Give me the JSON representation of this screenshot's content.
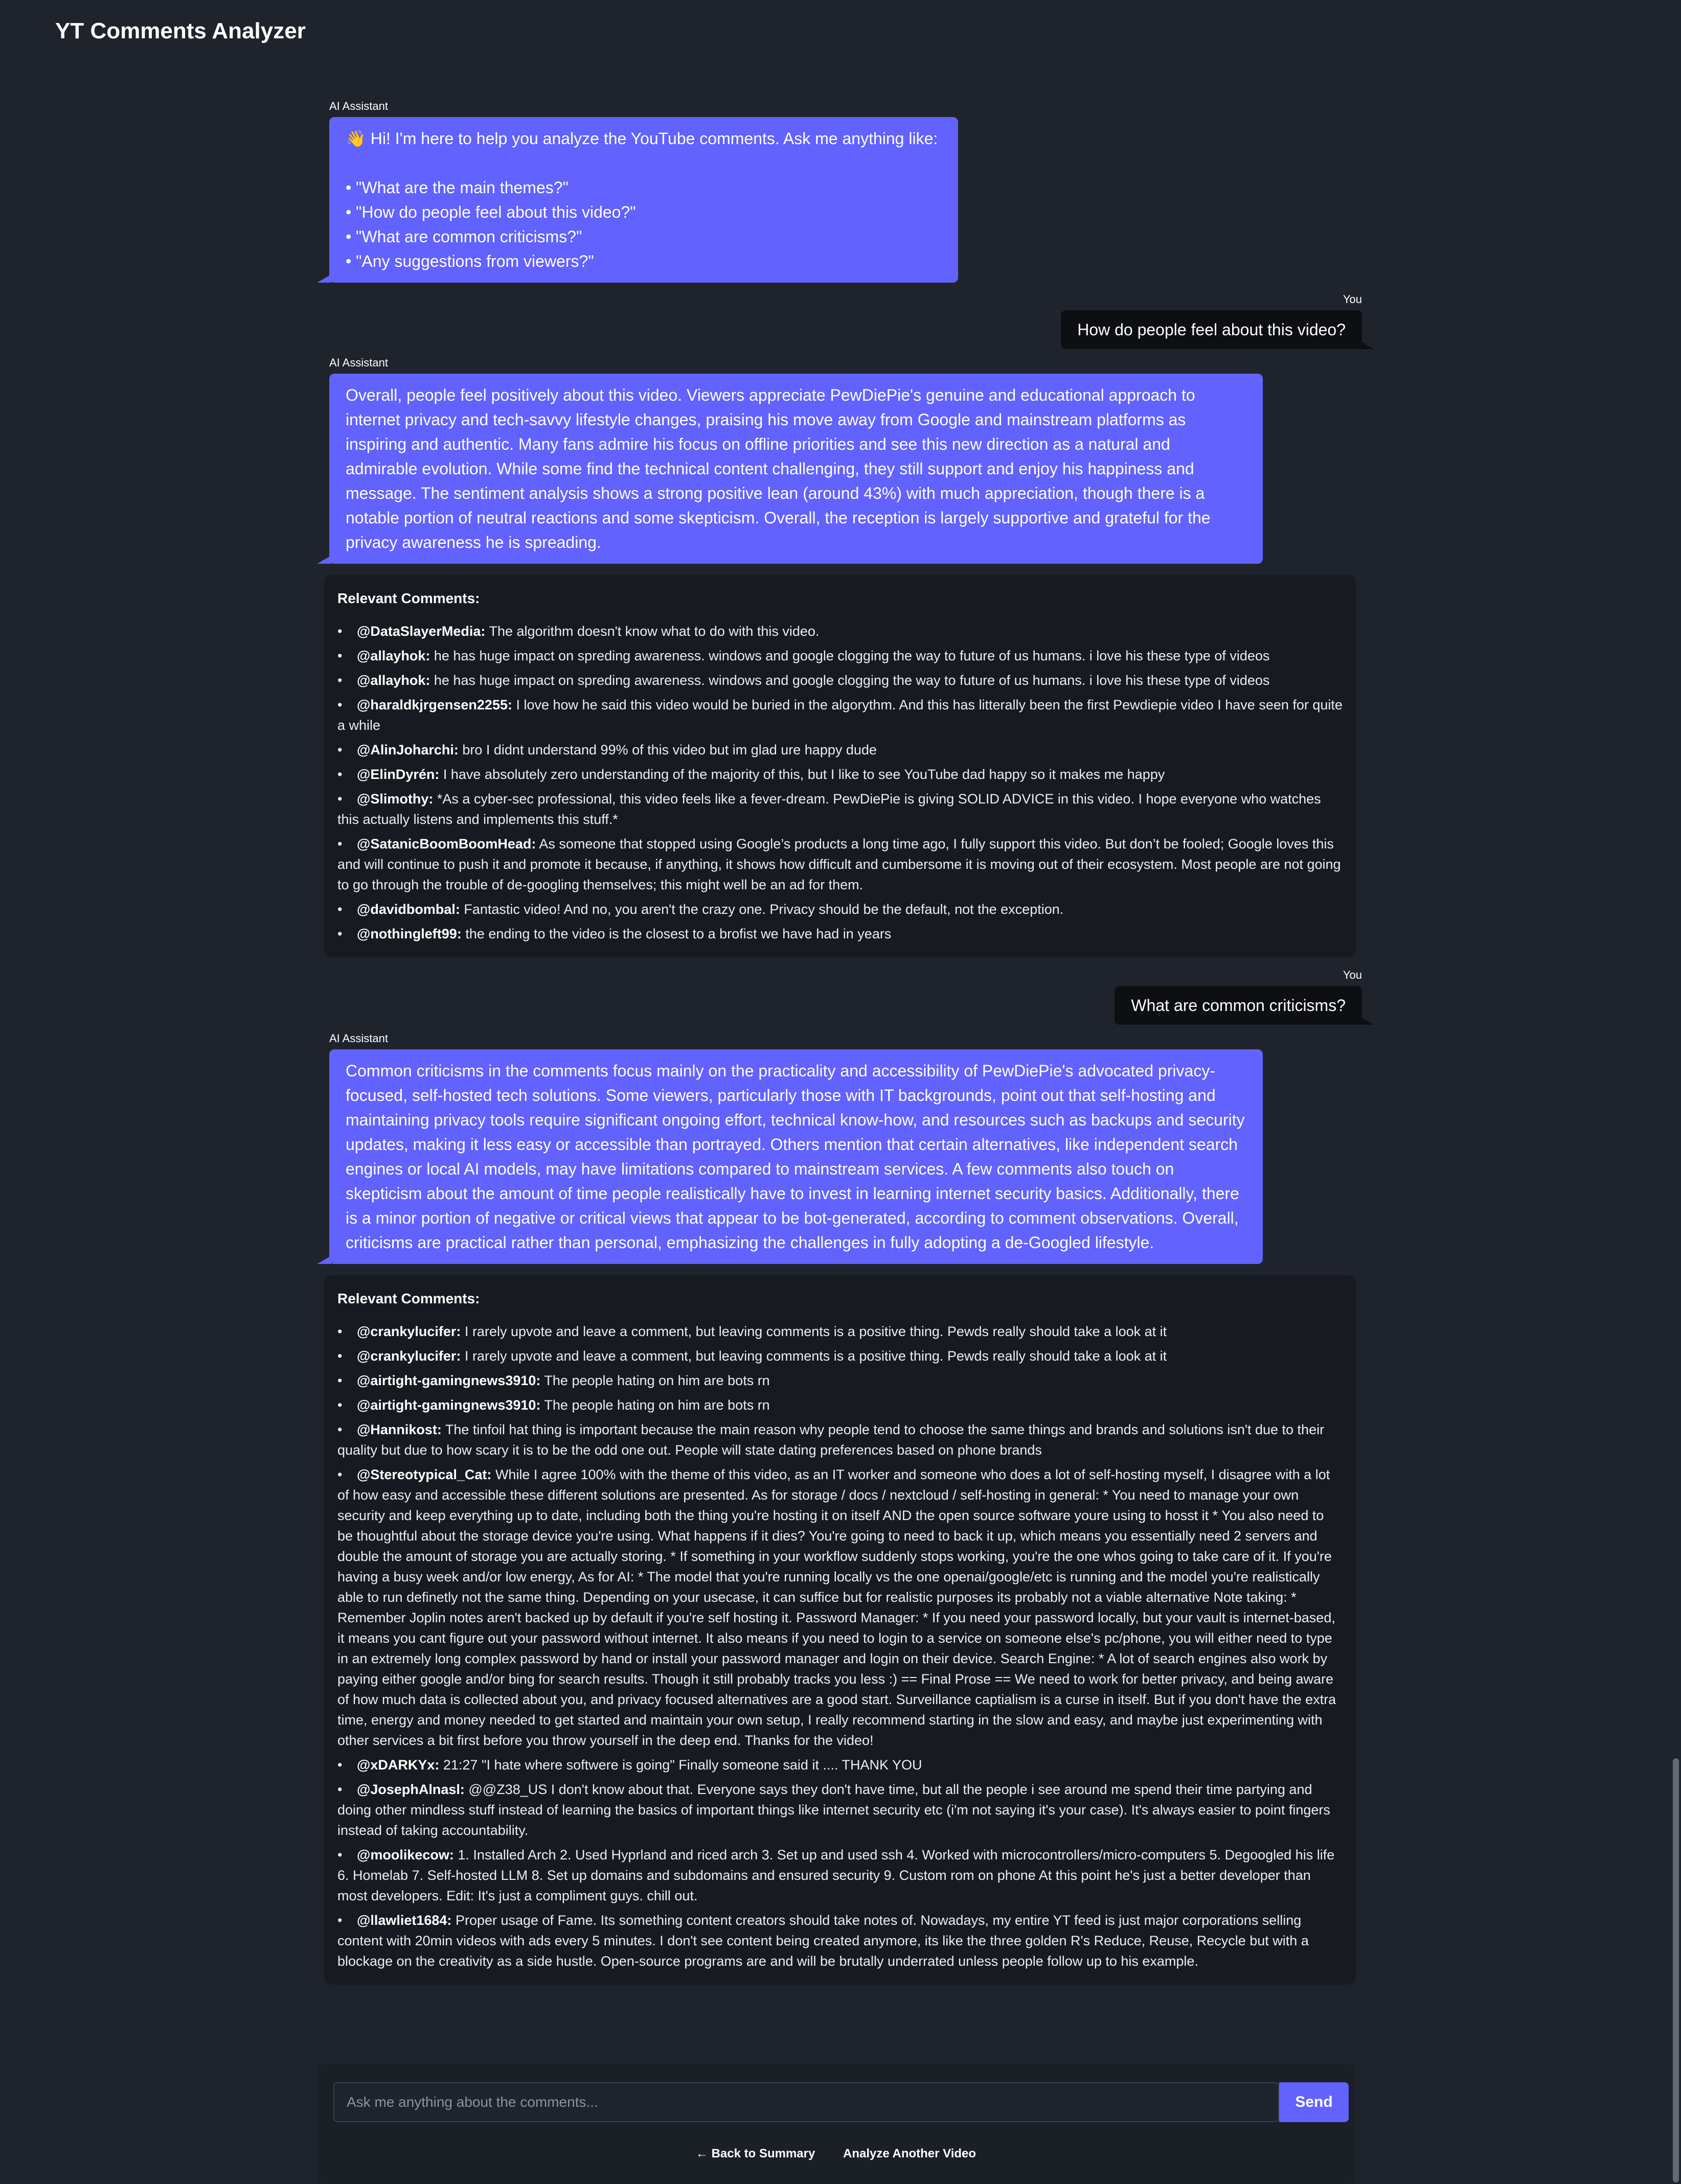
{
  "app": {
    "title": "YT Comments Analyzer"
  },
  "labels": {
    "ai": "AI Assistant",
    "user": "You"
  },
  "greeting": {
    "text": "👋 Hi! I'm here to help you analyze the YouTube comments. Ask me anything like:",
    "examples": [
      "• \"What are the main themes?\"",
      "• \"How do people feel about this video?\"",
      "• \"What are common criticisms?\"",
      "• \"Any suggestions from viewers?\""
    ]
  },
  "q1": {
    "text": "How do people feel about this video?"
  },
  "a1": {
    "text": "Overall, people feel positively about this video. Viewers appreciate PewDiePie's genuine and educational approach to internet privacy and tech-savvy lifestyle changes, praising his move away from Google and mainstream platforms as inspiring and authentic. Many fans admire his focus on offline priorities and see this new direction as a natural and admirable evolution. While some find the technical content challenging, they still support and enjoy his happiness and message. The sentiment analysis shows a strong positive lean (around 43%) with much appreciation, though there is a notable portion of neutral reactions and some skepticism. Overall, the reception is largely supportive and grateful for the privacy awareness he is spreading."
  },
  "comments_title": "Relevant Comments:",
  "c1": [
    {
      "user": "@DataSlayerMedia:",
      "text": "The algorithm doesn't know what to do with this video."
    },
    {
      "user": "@allayhok:",
      "text": "he has huge impact on spreding awareness. windows and google clogging the way to future of us humans. i love his these type of videos"
    },
    {
      "user": "@allayhok:",
      "text": "he has huge impact on spreding awareness. windows and google clogging the way to future of us humans. i love his these type of videos"
    },
    {
      "user": "@haraldkjrgensen2255:",
      "text": "I love how he said this video would be buried in the algorythm. And this has litterally been the first Pewdiepie video I have seen for quite a while"
    },
    {
      "user": "@AlinJoharchi:",
      "text": "bro I didnt understand 99% of this video but im glad ure happy dude"
    },
    {
      "user": "@ElinDyrén:",
      "text": "I have absolutely zero understanding of the majority of this, but I like to see YouTube dad happy so it makes me happy"
    },
    {
      "user": "@Slimothy:",
      "text": "*As a cyber-sec professional, this video feels like a fever-dream. PewDiePie is giving SOLID ADVICE in this video. I hope everyone who watches this actually listens and implements this stuff.*"
    },
    {
      "user": "@SatanicBoomBoomHead:",
      "text": "As someone that stopped using Google’s products a long time ago, I fully support this video. But don’t be fooled; Google loves this and will continue to push it and promote it because, if anything, it shows how difficult and cumbersome it is moving out of their ecosystem. Most people are not going to go through the trouble of de-googling themselves; this might well be an ad for them."
    },
    {
      "user": "@davidbombal:",
      "text": "Fantastic video! And no, you aren't the crazy one. Privacy should be the default, not the exception."
    },
    {
      "user": "@nothingleft99:",
      "text": "the ending to the video is the closest to a brofist we have had in years"
    }
  ],
  "q2": {
    "text": "What are common criticisms?"
  },
  "a2": {
    "text": "Common criticisms in the comments focus mainly on the practicality and accessibility of PewDiePie's advocated privacy-focused, self-hosted tech solutions. Some viewers, particularly those with IT backgrounds, point out that self-hosting and maintaining privacy tools require significant ongoing effort, technical know-how, and resources such as backups and security updates, making it less easy or accessible than portrayed. Others mention that certain alternatives, like independent search engines or local AI models, may have limitations compared to mainstream services. A few comments also touch on skepticism about the amount of time people realistically have to invest in learning internet security basics. Additionally, there is a minor portion of negative or critical views that appear to be bot-generated, according to comment observations. Overall, criticisms are practical rather than personal, emphasizing the challenges in fully adopting a de-Googled lifestyle."
  },
  "c2": [
    {
      "user": "@crankylucifer:",
      "text": "I rarely upvote and leave a comment, but leaving comments is a positive thing. Pewds really should take a look at it"
    },
    {
      "user": "@crankylucifer:",
      "text": "I rarely upvote and leave a comment, but leaving comments is a positive thing. Pewds really should take a look at it"
    },
    {
      "user": "@airtight-gamingnews3910:",
      "text": "The people hating on him are bots rn"
    },
    {
      "user": "@airtight-gamingnews3910:",
      "text": "The people hating on him are bots rn"
    },
    {
      "user": "@Hannikost:",
      "text": "The tinfoil hat thing is important because the main reason why people tend to choose the same things and brands and solutions isn't due to their quality but due to how scary it is to be the odd one out. People will state dating preferences based on phone brands"
    },
    {
      "user": "@Stereotypical_Cat:",
      "text": "While I agree 100% with the theme of this video, as an IT worker and someone who does a lot of self-hosting myself, I disagree with a lot of how easy and accessible these different solutions are presented. As for storage / docs / nextcloud / self-hosting in general: * You need to manage your own security and keep everything up to date, including both the thing you're hosting it on itself AND the open source software youre using to hosst it * You also need to be thoughtful about the storage device you're using. What happens if it dies? You're going to need to back it up, which means you essentially need 2 servers and double the amount of storage you are actually storing. * If something in your workflow suddenly stops working, you're the one whos going to take care of it. If you're having a busy week and/or low energy, As for AI: * The model that you're running locally vs the one openai/google/etc is running and the model you're realistically able to run definetly not the same thing. Depending on your usecase, it can suffice but for realistic purposes its probably not a viable alternative Note taking: * Remember Joplin notes aren't backed up by default if you're self hosting it. Password Manager: * If you need your password locally, but your vault is internet-based, it means you cant figure out your password without internet. It also means if you need to login to a service on someone else's pc/phone, you will either need to type in an extremely long complex password by hand or install your password manager and login on their device. Search Engine: * A lot of search engines also work by paying either google and/or bing for search results. Though it still probably tracks you less :) == Final Prose == We need to work for better privacy, and being aware of how much data is collected about you, and privacy focused alternatives are a good start. Surveillance captialism is a curse in itself. But if you don't have the extra time, energy and money needed to get started and maintain your own setup, I really recommend starting in the slow and easy, and maybe just experimenting with other services a bit first before you throw yourself in the deep end. Thanks for the video!"
    },
    {
      "user": "@xDARKYx:",
      "text": "21:27 \"I hate where softwere is going\" Finally someone said it .... THANK YOU"
    },
    {
      "user": "@JosephAlnasl:",
      "text": "@@Z38_US I don't know about that. Everyone says they don't have time, but all the people i see around me spend their time partying and doing other mindless stuff instead of learning the basics of important things like internet security etc (i'm not saying it's your case). It's always easier to point fingers instead of taking accountability."
    },
    {
      "user": "@moolikecow:",
      "text": "1. Installed Arch 2. Used Hyprland and riced arch 3. Set up and used ssh 4. Worked with microcontrollers/micro-computers 5. Degoogled his life 6. Homelab 7. Self-hosted LLM 8. Set up domains and subdomains and ensured security 9. Custom rom on phone At this point he's just a better developer than most developers. Edit: It's just a compliment guys. chill out."
    },
    {
      "user": "@llawliet1684:",
      "text": "Proper usage of Fame. Its something content creators should take notes of. Nowadays, my entire YT feed is just major corporations selling content with 20min videos with ads every 5 minutes. I don't see content being created anymore, its like the three golden R's Reduce, Reuse, Recycle but with a blockage on the creativity as a side hustle. Open-source programs are and will be brutally underrated unless people follow up to his example."
    }
  ],
  "input": {
    "placeholder": "Ask me anything about the comments...",
    "send_label": "Send"
  },
  "footer": {
    "back_label": "← Back to Summary",
    "another_label": "Analyze Another Video"
  }
}
